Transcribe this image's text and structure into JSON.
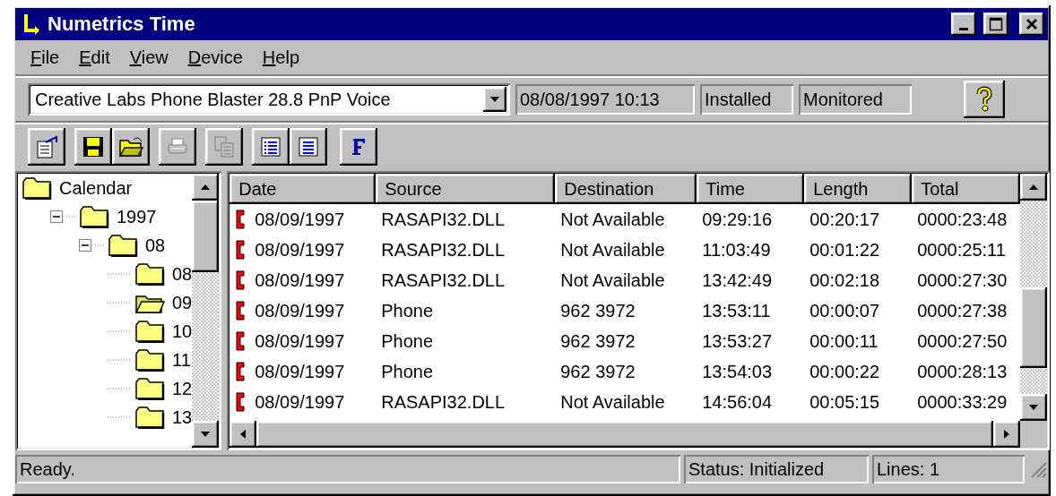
{
  "window": {
    "title": "Numetrics Time"
  },
  "menu": [
    {
      "label": "File"
    },
    {
      "label": "Edit"
    },
    {
      "label": "View"
    },
    {
      "label": "Device"
    },
    {
      "label": "Help"
    }
  ],
  "device_bar": {
    "device": "Creative Labs Phone Blaster 28.8 PnP Voice",
    "datetime": "08/08/1997 10:13",
    "install_status": "Installed",
    "monitor_status": "Monitored"
  },
  "toolbar": [
    {
      "kind": "properties",
      "disabled": false
    },
    {
      "kind": "save",
      "disabled": false
    },
    {
      "kind": "open",
      "disabled": false
    },
    {
      "kind": "print",
      "disabled": true
    },
    {
      "kind": "copy",
      "disabled": true
    },
    {
      "kind": "details",
      "disabled": false
    },
    {
      "kind": "list",
      "disabled": false
    },
    {
      "kind": "font",
      "disabled": false
    }
  ],
  "tree": [
    {
      "label": "Calendar",
      "children": [
        {
          "label": "1997",
          "expanded": true,
          "children": [
            {
              "label": "08",
              "expanded": true,
              "children": [
                {
                  "label": "08",
                  "open": false
                },
                {
                  "label": "09",
                  "open": true
                },
                {
                  "label": "10",
                  "open": false
                },
                {
                  "label": "11",
                  "open": false
                },
                {
                  "label": "12",
                  "open": false
                },
                {
                  "label": "13",
                  "open": false
                }
              ]
            }
          ]
        }
      ]
    }
  ],
  "table": {
    "columns": [
      "Date",
      "Source",
      "Destination",
      "Time",
      "Length",
      "Total"
    ],
    "rows": [
      [
        "08/09/1997",
        "RASAPI32.DLL",
        "Not Available",
        "09:29:16",
        "00:20:17",
        "0000:23:48"
      ],
      [
        "08/09/1997",
        "RASAPI32.DLL",
        "Not Available",
        "11:03:49",
        "00:01:22",
        "0000:25:11"
      ],
      [
        "08/09/1997",
        "RASAPI32.DLL",
        "Not Available",
        "13:42:49",
        "00:02:18",
        "0000:27:30"
      ],
      [
        "08/09/1997",
        "Phone",
        "962 3972",
        "13:53:11",
        "00:00:07",
        "0000:27:38"
      ],
      [
        "08/09/1997",
        "Phone",
        "962 3972",
        "13:53:27",
        "00:00:11",
        "0000:27:50"
      ],
      [
        "08/09/1997",
        "Phone",
        "962 3972",
        "13:54:03",
        "00:00:22",
        "0000:28:13"
      ],
      [
        "08/09/1997",
        "RASAPI32.DLL",
        "Not Available",
        "14:56:04",
        "00:05:15",
        "0000:33:29"
      ]
    ]
  },
  "status_bar": [
    "Ready.",
    "Status: Initialized",
    "Lines: 1"
  ]
}
